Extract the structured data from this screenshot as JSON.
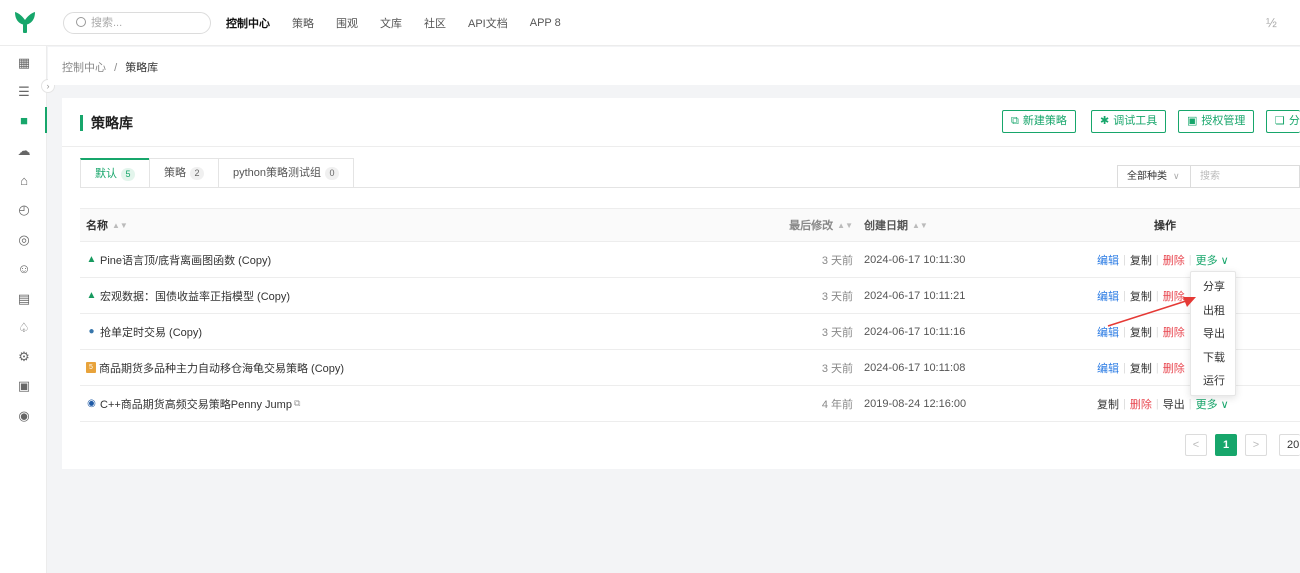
{
  "topbar": {
    "search_placeholder": "搜索...",
    "nav": [
      "控制中心",
      "策略",
      "围观",
      "文库",
      "社区",
      "API文档",
      "APP 8"
    ],
    "active_nav": "控制中心",
    "right_glyph": "½"
  },
  "sidebar": {
    "icons": [
      "dashboard-icon",
      "list-icon",
      "strategy-cube-icon",
      "cloud-icon",
      "bank-icon",
      "gauge-icon",
      "radar-icon",
      "user-settings-icon",
      "document-icon",
      "bell-icon",
      "gear-icon",
      "badge-icon",
      "piggy-icon"
    ],
    "active_index": 2
  },
  "breadcrumb": {
    "root": "控制中心",
    "separator": "/",
    "current": "策略库"
  },
  "card": {
    "title": "策略库",
    "buttons": [
      {
        "label": "新建策略",
        "icon": "new-strategy-icon"
      },
      {
        "label": "调试工具",
        "icon": "bug-icon"
      },
      {
        "label": "授权管理",
        "icon": "auth-icon"
      },
      {
        "label": "分",
        "icon": "copy-icon"
      }
    ]
  },
  "tabs": [
    {
      "label": "默认",
      "count": "5",
      "active": true
    },
    {
      "label": "策略",
      "count": "2",
      "active": false
    },
    {
      "label": "python策略测试组",
      "count": "0",
      "active": false
    }
  ],
  "filter": {
    "kind": "全部种类",
    "search_placeholder": "搜索"
  },
  "table": {
    "headers": {
      "name": "名称",
      "modified": "最后修改",
      "created": "创建日期",
      "ops": "操作"
    },
    "rows": [
      {
        "icon": "pine-icon",
        "name": "Pine语言顶/底背离画图函数 (Copy)",
        "modified": "3 天前",
        "created": "2024-06-17 10:11:30",
        "ops": [
          "编辑",
          "复制",
          "删除",
          "更多"
        ]
      },
      {
        "icon": "pine-icon",
        "name": "宏观数据：国债收益率正指模型 (Copy)",
        "modified": "3 天前",
        "created": "2024-06-17 10:11:21",
        "ops": [
          "编辑",
          "复制",
          "删除"
        ]
      },
      {
        "icon": "python-icon",
        "name": "抢单定时交易 (Copy)",
        "modified": "3 天前",
        "created": "2024-06-17 10:11:16",
        "ops": [
          "编辑",
          "复制",
          "删除"
        ]
      },
      {
        "icon": "javascript-icon",
        "name": "商品期货多品种主力自动移仓海龟交易策略 (Copy)",
        "modified": "3 天前",
        "created": "2024-06-17 10:11:08",
        "ops": [
          "编辑",
          "复制",
          "删除"
        ]
      },
      {
        "icon": "cpp-icon",
        "name": "C++商品期货高频交易策略Penny Jump",
        "modified": "4 年前",
        "created": "2019-08-24 12:16:00",
        "ops": [
          "复制",
          "删除",
          "导出",
          "更多"
        ]
      }
    ]
  },
  "more_menu": [
    "分享",
    "出租",
    "导出",
    "下载",
    "运行"
  ],
  "pagination": {
    "prev": "<",
    "current": "1",
    "next": ">",
    "page_size": "20"
  },
  "colors": {
    "accent": "#17a66b",
    "link": "#2a7be4",
    "danger": "#e8464f",
    "arrow": "#e53935"
  }
}
